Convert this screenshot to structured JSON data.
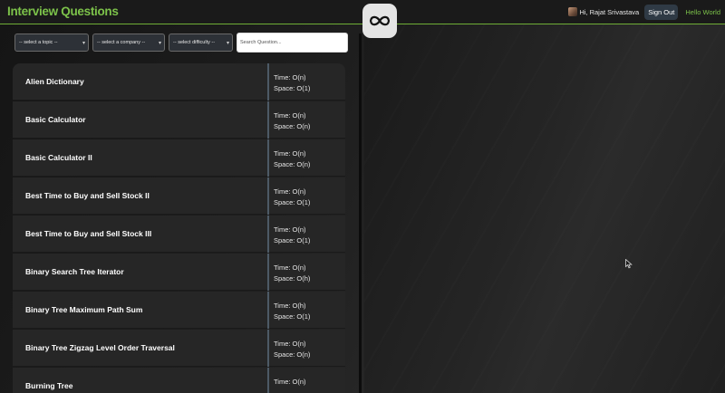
{
  "header": {
    "title": "Interview Questions",
    "greeting": "Hi, Rajat Srivastava",
    "signout_label": "Sign Out",
    "hello_link": "Hello World",
    "logo_icon": "infinity-code-icon",
    "accent_color": "#7cc24a"
  },
  "filters": {
    "topic": "-- select a topic --",
    "company": "-- select a company --",
    "difficulty": "-- select difficulty --",
    "search_placeholder": "Search Question..."
  },
  "questions": [
    {
      "name": "Alien Dictionary",
      "time": "Time: O(n)",
      "space": "Space: O(1)"
    },
    {
      "name": "Basic Calculator",
      "time": "Time: O(n)",
      "space": "Space: O(n)"
    },
    {
      "name": "Basic Calculator II",
      "time": "Time: O(n)",
      "space": "Space: O(n)"
    },
    {
      "name": "Best Time to Buy and Sell Stock II",
      "time": "Time: O(n)",
      "space": "Space: O(1)"
    },
    {
      "name": "Best Time to Buy and Sell Stock III",
      "time": "Time: O(n)",
      "space": "Space: O(1)"
    },
    {
      "name": "Binary Search Tree Iterator",
      "time": "Time: O(n)",
      "space": "Space: O(h)"
    },
    {
      "name": "Binary Tree Maximum Path Sum",
      "time": "Time: O(h)",
      "space": "Space: O(1)"
    },
    {
      "name": "Binary Tree Zigzag Level Order Traversal",
      "time": "Time: O(n)",
      "space": "Space: O(n)"
    },
    {
      "name": "Burning Tree",
      "time": "Time: O(n)",
      "space": ""
    }
  ]
}
